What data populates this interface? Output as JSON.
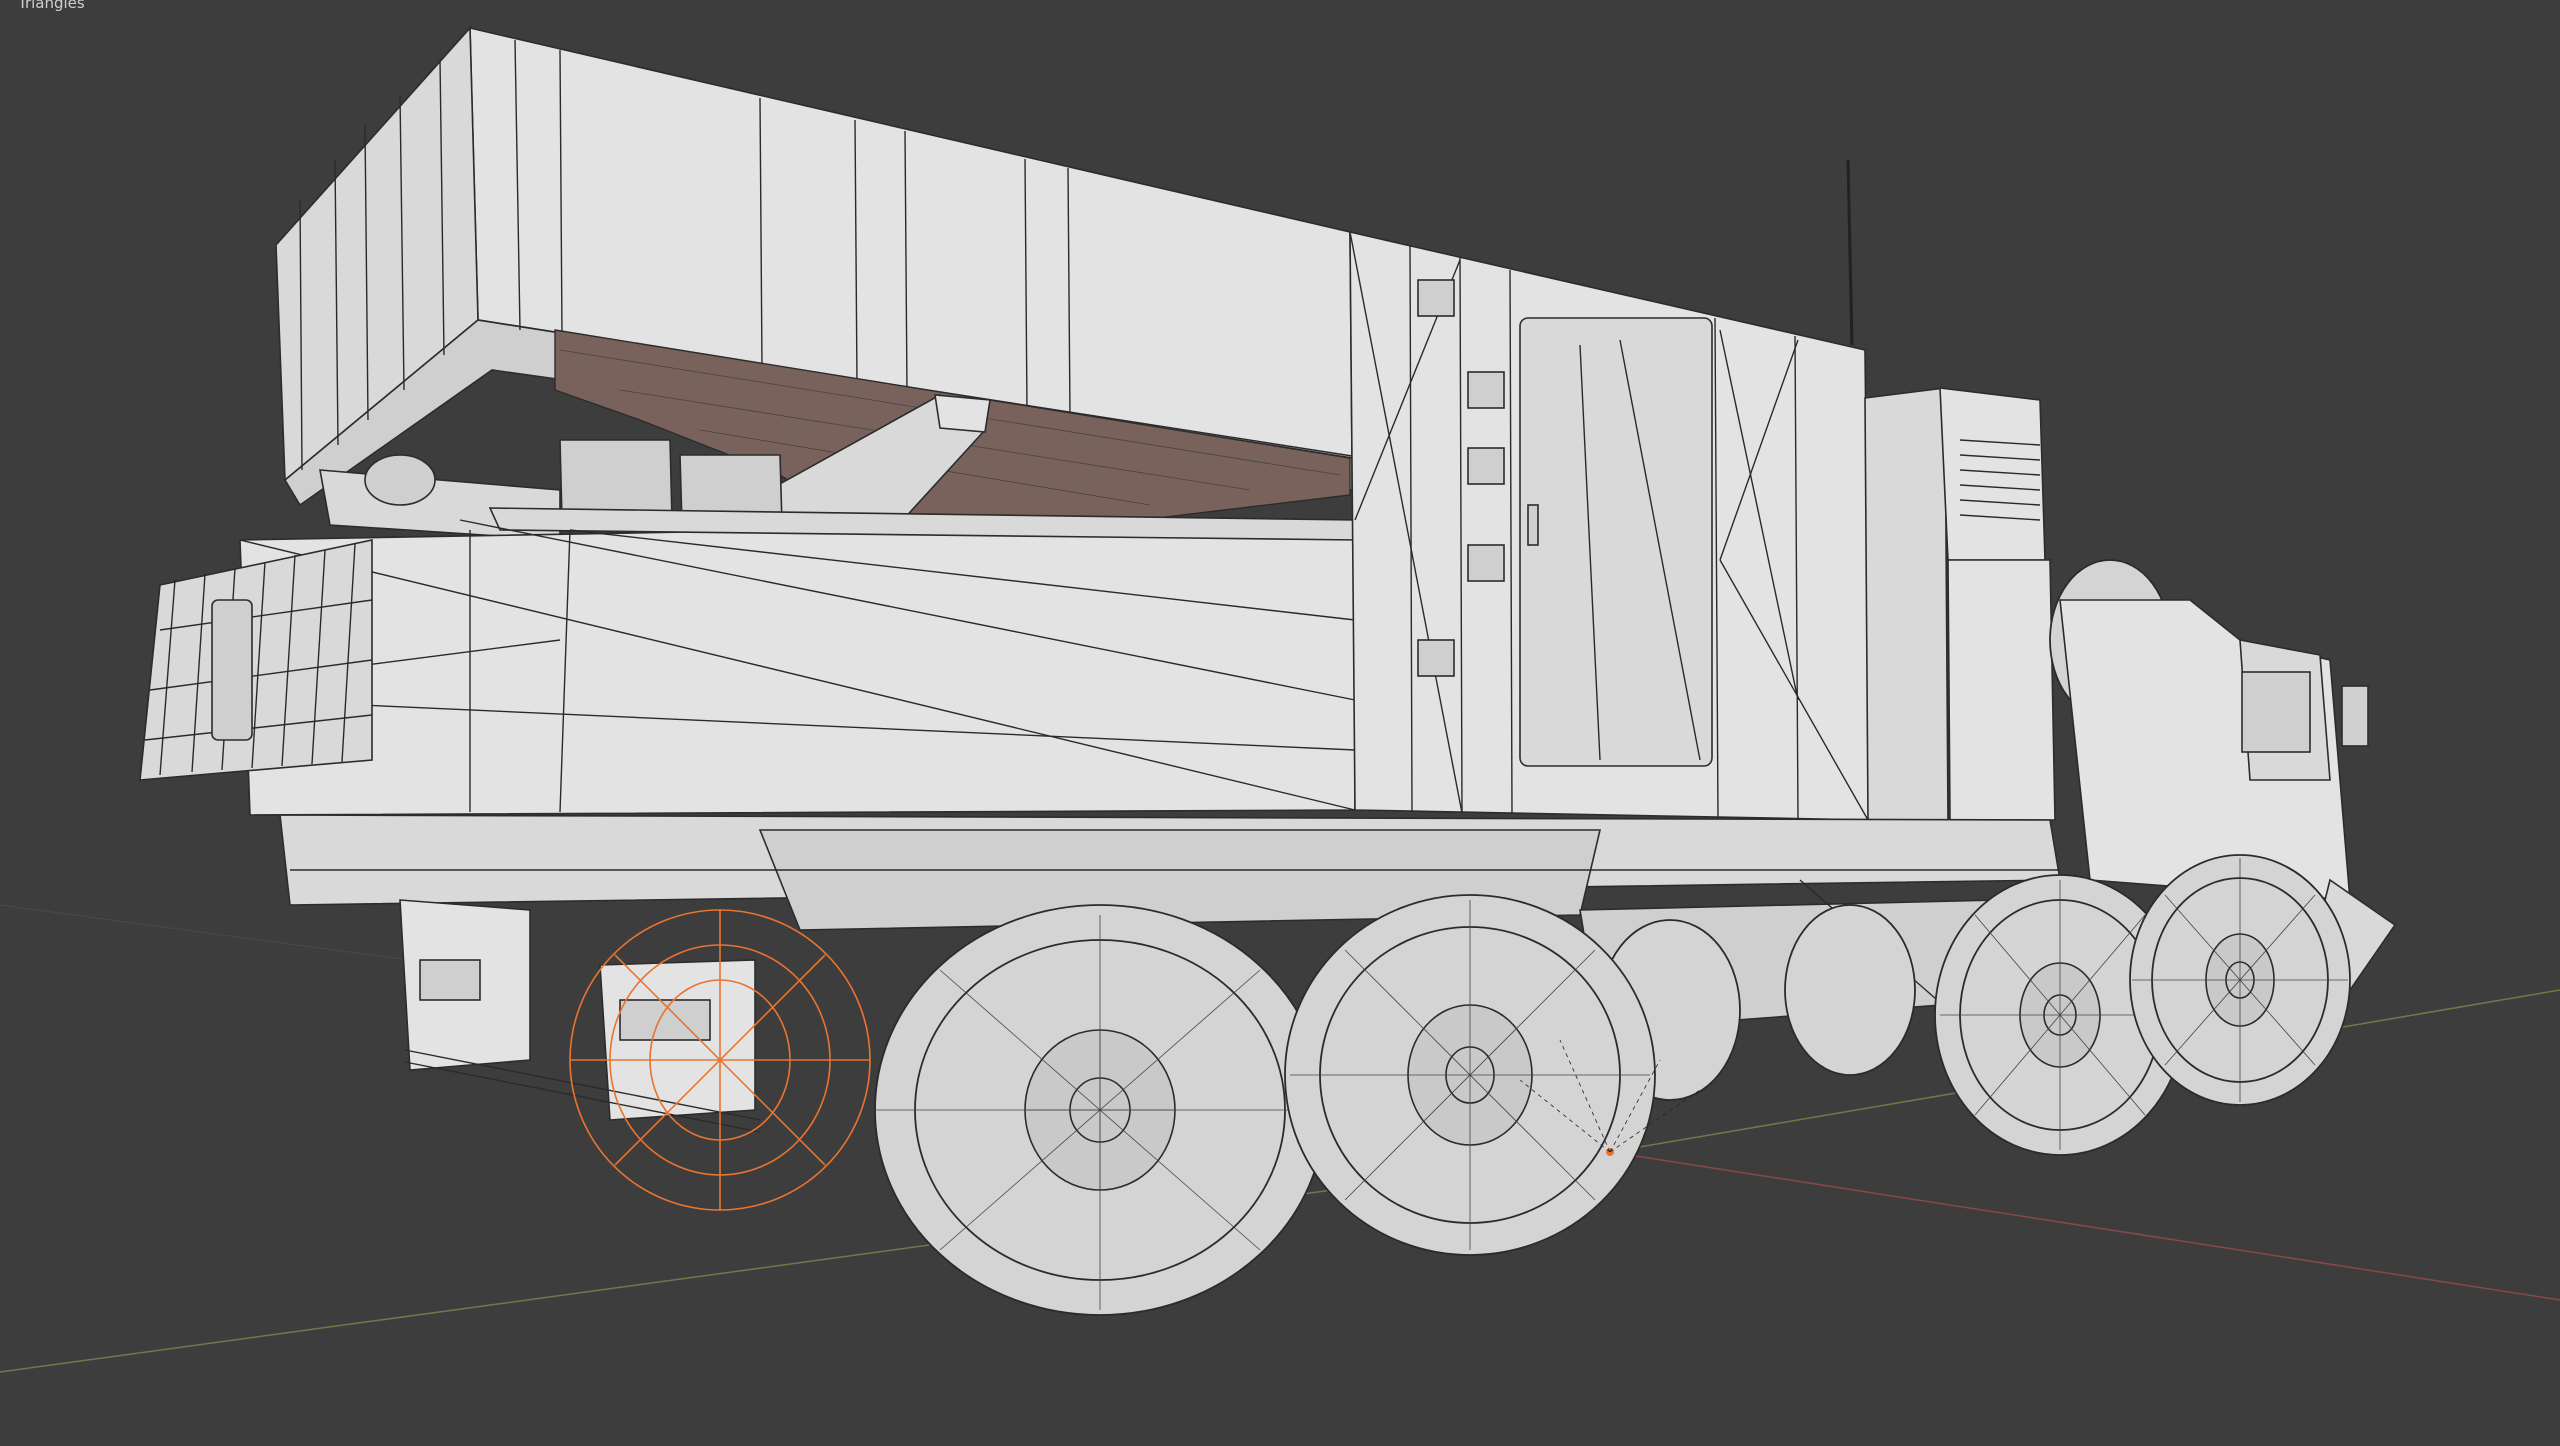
{
  "viewport": {
    "stats_label": "Triangles",
    "stats_value": "",
    "background": "#3d3d3d",
    "selection_color": "#e8742f"
  },
  "scene": {
    "object": "truck-wireframe",
    "wheel_count_visible": 4
  }
}
